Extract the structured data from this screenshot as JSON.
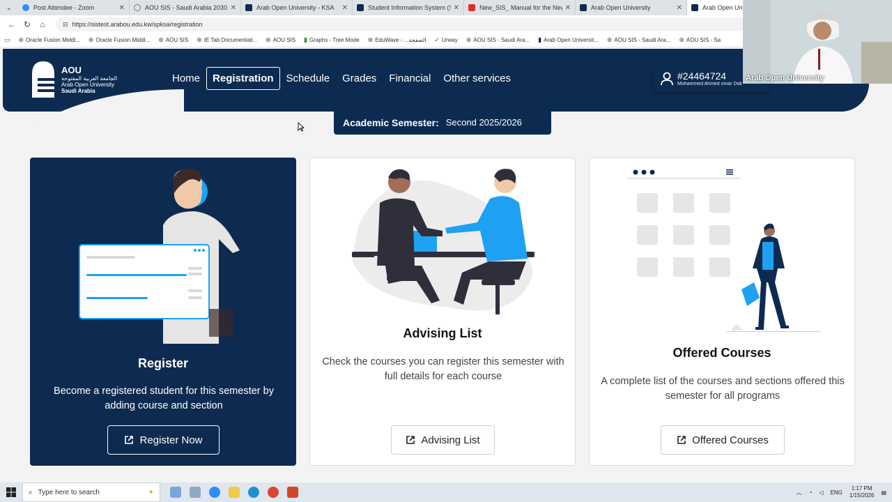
{
  "browser": {
    "tabs": [
      {
        "title": "Post Attendee - Zoom",
        "color": "#2d8cff"
      },
      {
        "title": "AOU SIS - Saudi Arabia 2030",
        "color": "#777777"
      },
      {
        "title": "Arab Open University - KSA",
        "color": "#0d2b50"
      },
      {
        "title": "Student Information System (SIS)",
        "color": "#0d2b50"
      },
      {
        "title": "New_SIS_ Manual for the New St...",
        "color": "#d93025"
      },
      {
        "title": "Arab Open University",
        "color": "#0d2b50"
      },
      {
        "title": "Arab Open Univers",
        "color": "#0d2b50"
      }
    ],
    "url": "https://sistest.arabou.edu.kw/spksa/registration",
    "bookmarks": [
      "Oracle Fusion Middl...",
      "Oracle Fusion Middl...",
      "AOU SIS",
      "IE Tab Documentati...",
      "AOU SIS",
      "Graphs - Tree Mode",
      "EduWave - ...الصفحة",
      "Urway",
      "AOU SIS - Saudi Ara...",
      "Arab Open Universit...",
      "AOU SIS - Saudi Ara...",
      "AOU SIS - Sa"
    ]
  },
  "header": {
    "logo": {
      "abbr": "AOU",
      "arabic": "الجامعة العربية المفتوحة",
      "english": "Arab Open University",
      "region": "Saudi Arabia"
    },
    "nav": [
      {
        "label": "Home",
        "active": false
      },
      {
        "label": "Registration",
        "active": true
      },
      {
        "label": "Schedule",
        "active": false
      },
      {
        "label": "Grades",
        "active": false
      },
      {
        "label": "Financial",
        "active": false
      },
      {
        "label": "Other services",
        "active": false
      }
    ],
    "user": {
      "id": "#24464724",
      "name": "Mohammed Ahmed omar Didi"
    }
  },
  "semester": {
    "label": "Academic Semester:",
    "value": "Second 2025/2026"
  },
  "cards": [
    {
      "title": "Register",
      "description": "Become a registered student for this semester by adding course and section",
      "button": "Register Now"
    },
    {
      "title": "Advising List",
      "description": "Check the courses you can register this semester with full details for each course",
      "button": "Advising List"
    },
    {
      "title": "Offered Courses",
      "description": "A complete list of the courses and sections offered this semester for all programs",
      "button": "Offered Courses"
    }
  ],
  "video_overlay": {
    "name": "Arab Open University"
  },
  "taskbar": {
    "search_placeholder": "Type here to search",
    "language": "ENG",
    "time": "1:17 PM",
    "date": "1/15/2026"
  },
  "colors": {
    "brand_navy": "#0d2b50",
    "accent_blue": "#1ea1f2",
    "page_bg": "#f3f3f3"
  }
}
